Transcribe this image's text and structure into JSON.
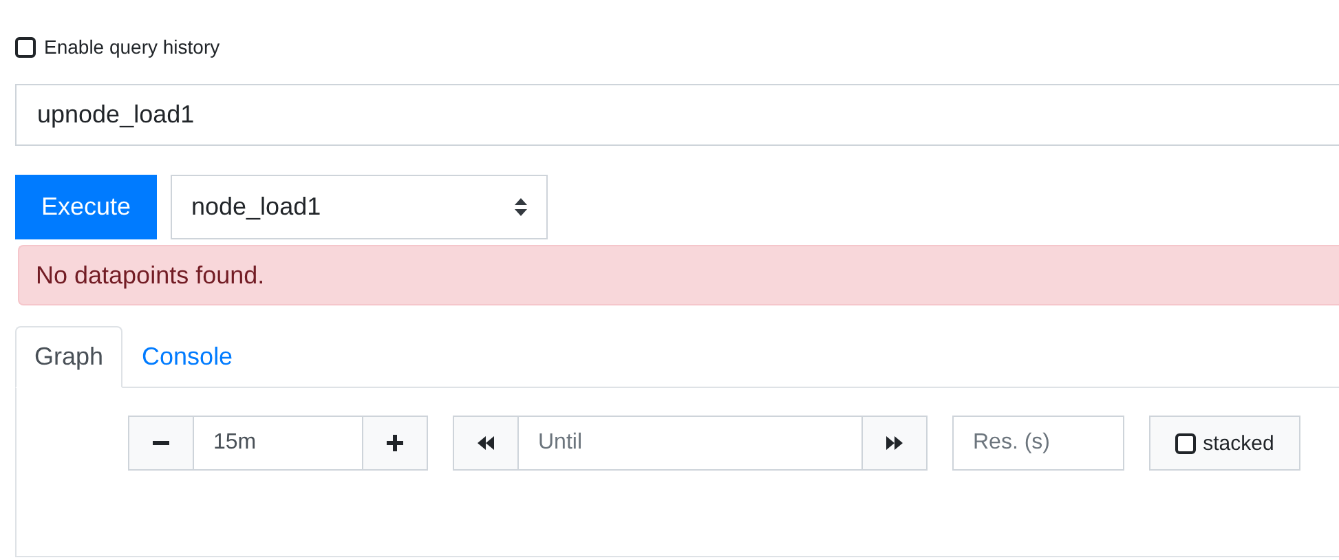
{
  "history": {
    "label": "Enable query history",
    "checked": false
  },
  "query": {
    "value": "upnode_load1"
  },
  "execute_button": "Execute",
  "metric_select": {
    "value": "node_load1"
  },
  "alert": "No datapoints found.",
  "tabs": [
    {
      "label": "Graph",
      "selected": true
    },
    {
      "label": "Console",
      "selected": false
    }
  ],
  "graph_controls": {
    "range": {
      "value": "15m"
    },
    "until": {
      "placeholder": "Until"
    },
    "resolution": {
      "placeholder": "Res. (s)"
    },
    "stacked": {
      "label": "stacked",
      "checked": false
    }
  }
}
